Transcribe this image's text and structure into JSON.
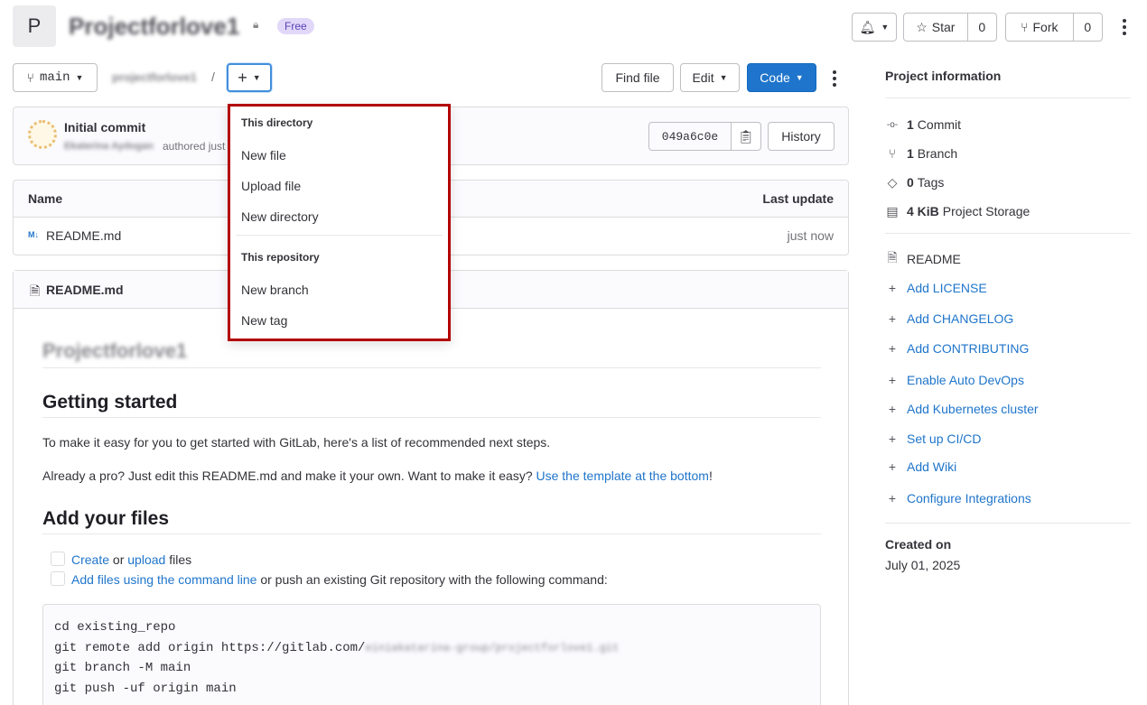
{
  "project": {
    "avatar_letter": "P",
    "name": "Projectforlove1",
    "visibility_badge": "Free"
  },
  "header_actions": {
    "star_label": "Star",
    "star_count": "0",
    "fork_label": "Fork",
    "fork_count": "0"
  },
  "toolbar": {
    "branch": "main",
    "path_root": "projectforlove1",
    "path_sep": "/",
    "add_label": "+",
    "find_file": "Find file",
    "edit": "Edit",
    "code": "Code"
  },
  "dropdown": {
    "section1_title": "This directory",
    "items1": [
      "New file",
      "Upload file",
      "New directory"
    ],
    "section2_title": "This repository",
    "items2": [
      "New branch",
      "New tag"
    ]
  },
  "commit": {
    "title": "Initial commit",
    "author": "Ekaterina Aydogan",
    "authored_text": "authored just now",
    "sha": "049a6c0e",
    "history": "History"
  },
  "file_table": {
    "col_name": "Name",
    "col_update": "Last update",
    "rows": [
      {
        "name": "README.md",
        "updated": "just now"
      }
    ]
  },
  "readme": {
    "header": "README.md",
    "h1": "Projectforlove1",
    "h2_started": "Getting started",
    "p1": "To make it easy for you to get started with GitLab, here's a list of recommended next steps.",
    "p2_pre": "Already a pro? Just edit this README.md and make it your own. Want to make it easy? ",
    "p2_link": "Use the template at the bottom",
    "p2_post": "!",
    "h2_files": "Add your files",
    "task1_link1": "Create",
    "task1_mid": " or ",
    "task1_link2": "upload",
    "task1_post": " files",
    "task2_link": "Add files using the command line",
    "task2_post": " or push an existing Git repository with the following command:",
    "code_lines": [
      "cd existing_repo",
      "git remote add origin https://gitlab.com/",
      "git branch -M main",
      "git push -uf origin main"
    ],
    "code_blurred": "einiakatarina-group/projectforlove1.git"
  },
  "sidebar": {
    "title": "Project information",
    "stats": [
      {
        "icon": "commit-icon",
        "glyph": "-o-",
        "count": "1",
        "label": "Commit"
      },
      {
        "icon": "branch-icon",
        "glyph": "⑂",
        "count": "1",
        "label": "Branch"
      },
      {
        "icon": "tag-icon",
        "glyph": "◇",
        "count": "0",
        "label": "Tags"
      },
      {
        "icon": "storage-icon",
        "glyph": "▤",
        "count": "4 KiB",
        "label": "Project Storage"
      }
    ],
    "readme": "README",
    "links": [
      "Add LICENSE",
      "Add CHANGELOG",
      "Add CONTRIBUTING",
      "Enable Auto DevOps",
      "Add Kubernetes cluster",
      "Set up CI/CD",
      "Add Wiki",
      "Configure Integrations"
    ],
    "created_label": "Created on",
    "created_date": "July 01, 2025"
  },
  "colors": {
    "accent": "#1f75cb",
    "highlight_border": "#b30000",
    "badge_bg": "#e1d8f9"
  }
}
